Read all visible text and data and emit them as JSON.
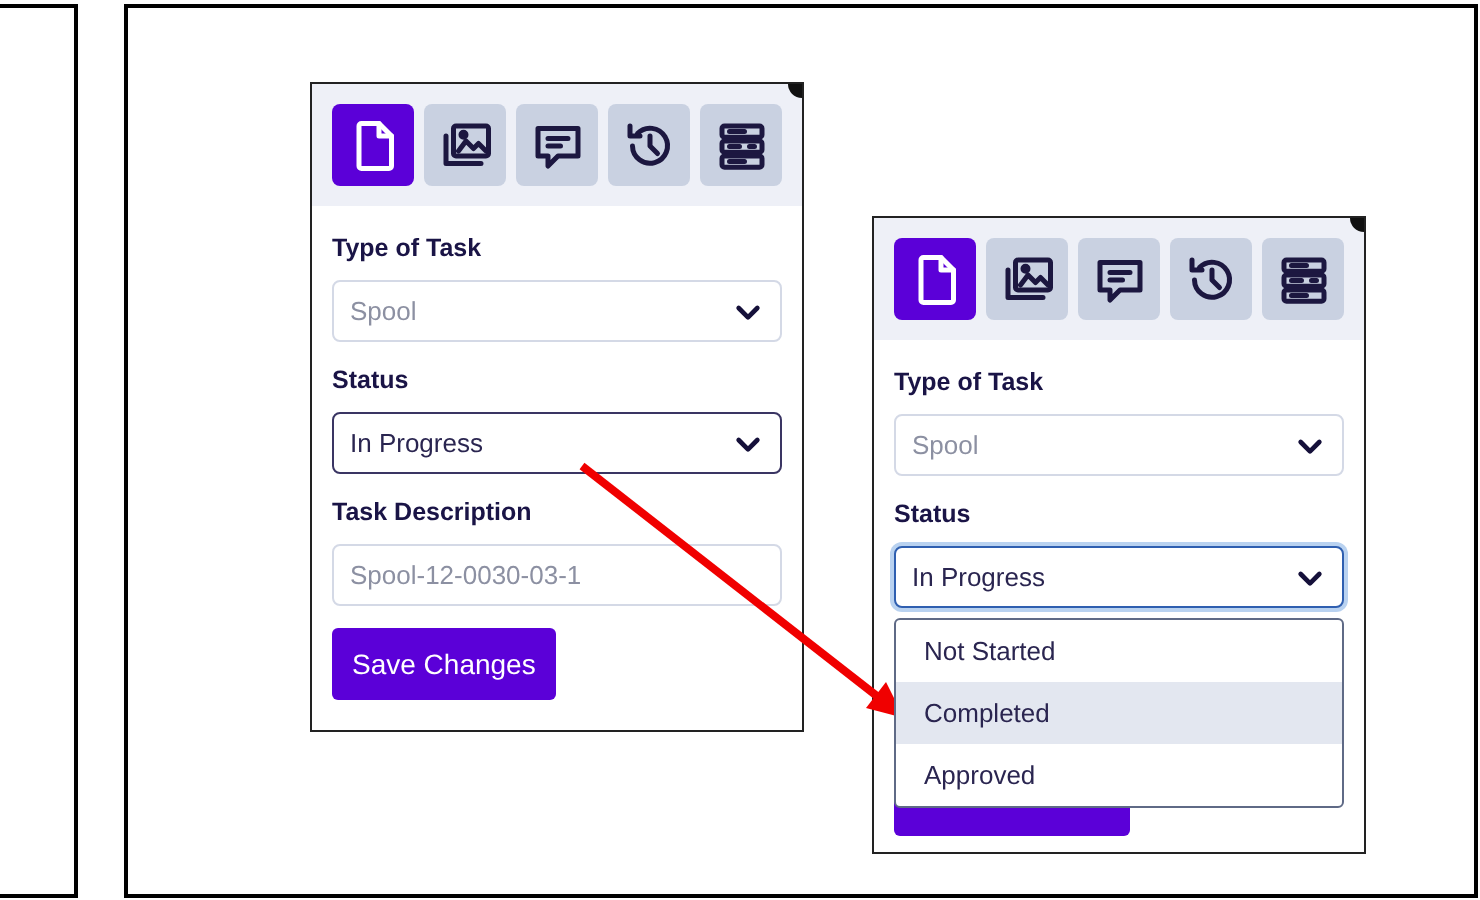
{
  "panels": [
    {
      "tabs": [
        {
          "kind": "document",
          "selected": true
        },
        {
          "kind": "images",
          "selected": false
        },
        {
          "kind": "comment",
          "selected": false
        },
        {
          "kind": "history",
          "selected": false
        },
        {
          "kind": "list",
          "selected": false
        }
      ],
      "fields": [
        {
          "label": "Type of Task",
          "kind": "select",
          "value": "Spool",
          "disabled": true,
          "focused": false
        },
        {
          "label": "Status",
          "kind": "select",
          "value": "In Progress",
          "disabled": false,
          "focused": false
        },
        {
          "label": "Task Description",
          "kind": "text",
          "placeholder": "Spool-12-0030-03-1",
          "focused": false
        }
      ],
      "button": {
        "label": "Save Changes"
      }
    },
    {
      "tabs": [
        {
          "kind": "document",
          "selected": true
        },
        {
          "kind": "images",
          "selected": false
        },
        {
          "kind": "comment",
          "selected": false
        },
        {
          "kind": "history",
          "selected": false
        },
        {
          "kind": "list",
          "selected": false
        }
      ],
      "fields": [
        {
          "label": "Type of Task",
          "kind": "select",
          "value": "Spool",
          "disabled": true,
          "focused": false
        },
        {
          "label": "Status",
          "kind": "select",
          "value": "In Progress",
          "disabled": false,
          "focused": true,
          "menu": [
            {
              "label": "Not Started",
              "selected": false
            },
            {
              "label": "Completed",
              "selected": true
            },
            {
              "label": "Approved",
              "selected": false
            }
          ]
        }
      ],
      "button": {
        "covered": true
      }
    }
  ]
}
